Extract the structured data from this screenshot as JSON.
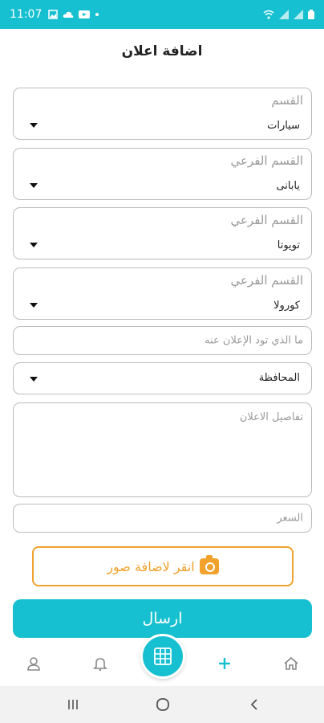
{
  "status_bar": {
    "time": "11:07",
    "left_icons": [
      "image-icon",
      "cloud-icon",
      "youtube-icon",
      "dot-icon"
    ],
    "right_icons": [
      "wifi-icon",
      "signal-icon",
      "signal-icon",
      "battery-icon"
    ]
  },
  "page": {
    "title": "اضافة اعلان"
  },
  "form": {
    "category": {
      "label": "القسم",
      "value": "سيارات"
    },
    "subcategory1": {
      "label": "القسم الفرعي",
      "value": "يابانى"
    },
    "subcategory2": {
      "label": "القسم الفرعي",
      "value": "تويوتا"
    },
    "subcategory3": {
      "label": "القسم الفرعي",
      "value": "كورولا"
    },
    "ad_title": {
      "placeholder": "ما الذي تود الإعلان عنه"
    },
    "governorate": {
      "value": "المحافظة"
    },
    "details": {
      "placeholder": "تفاصيل الاعلان"
    },
    "price": {
      "placeholder": "السعر"
    }
  },
  "add_photos": {
    "label": "انقر لاضافة صور",
    "icon": "camera-icon",
    "color": "#f0a22c"
  },
  "submit": {
    "label": "ارسال"
  },
  "bottom_nav": {
    "items": [
      "profile-icon",
      "bell-icon",
      "grid-icon",
      "plus-icon",
      "home-icon"
    ],
    "accent": "#17c0d0"
  },
  "system_nav": [
    "recents-icon",
    "home-circle-icon",
    "back-icon"
  ],
  "colors": {
    "primary": "#17c0d0",
    "accent_orange": "#f0a22c"
  }
}
